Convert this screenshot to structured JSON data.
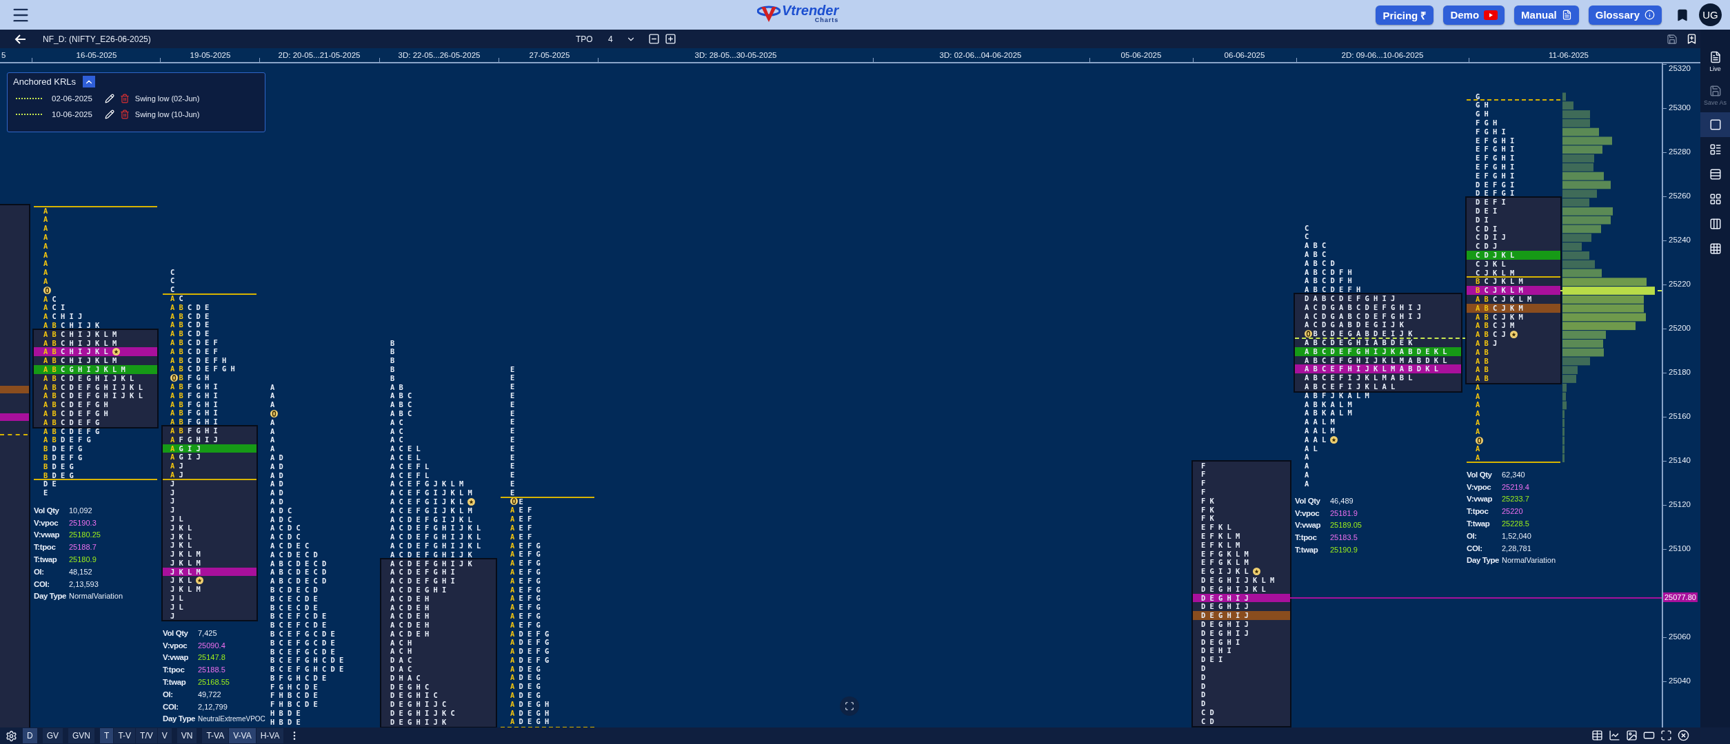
{
  "header": {
    "logo": "Vtrender",
    "logo_sub": "Charts",
    "buttons": [
      {
        "label": "Pricing ₹",
        "kind": "plain"
      },
      {
        "label": "Demo",
        "kind": "video"
      },
      {
        "label": "Manual",
        "kind": "doc"
      },
      {
        "label": "Glossary",
        "kind": "info"
      }
    ],
    "avatar": "UG"
  },
  "toolbar": {
    "title": "NF_D: (NIFTY_E26-06-2025)",
    "tpo_label": "TPO",
    "tpo_value": "4"
  },
  "timeline": [
    "5",
    "16-05-2025",
    "19-05-2025",
    "2D: 20-05...21-05-2025",
    "3D: 22-05...26-05-2025",
    "27-05-2025",
    "3D: 28-05...30-05-2025",
    "3D: 02-06...04-06-2025",
    "05-06-2025",
    "06-06-2025",
    "2D: 09-06...10-06-2025",
    "11-06-2025"
  ],
  "krl_panel": {
    "title": "Anchored KRLs",
    "expanded": true,
    "items": [
      {
        "date": "02-06-2025",
        "label": "Swing low (02-Jun)"
      },
      {
        "date": "10-06-2025",
        "label": "Swing low (10-Jun)"
      }
    ]
  },
  "profiles": [
    {
      "above": [
        {
          "ib": "A"
        },
        {
          "ib": "A"
        },
        {
          "ib": "A"
        },
        {
          "ib": "A"
        },
        {
          "ib": "A"
        },
        {
          "ib": "A"
        },
        {
          "ib": "A"
        },
        {
          "ib": "A"
        },
        {
          "ib": "A"
        },
        {
          "open": true
        },
        {
          "ib": "A",
          "tpos": "C"
        },
        {
          "ib": "A",
          "tpos": "C I"
        },
        {
          "ib": "A",
          "tpos": "C H I J"
        },
        {
          "ib": "A B",
          "tpos": "C H I J K"
        }
      ],
      "value_area": [
        {
          "ib": "A B",
          "tpos": "C H I J K L M"
        },
        {
          "ib": "A B",
          "tpos": "C H I J K L M"
        },
        {
          "ib": "A B",
          "tpos": "C H I J K L",
          "color": "#a8109c",
          "close": true
        },
        {
          "ib": "A B",
          "tpos": "C H I J K L M"
        },
        {
          "ib": "A B",
          "tpos": "C G H I J K L M",
          "color": "#169a16"
        },
        {
          "ib": "A B",
          "tpos": "C D E G H I J K L"
        },
        {
          "ib": "A B",
          "tpos": "C D E F G H I J K L"
        },
        {
          "ib": "A B",
          "tpos": "C D E F G H I J K L"
        },
        {
          "ib": "A B",
          "tpos": "C D E F G H"
        },
        {
          "ib": "A B",
          "tpos": "C D E F G H"
        },
        {
          "ib": "A B",
          "tpos": "C D E F G"
        }
      ],
      "below": [
        {
          "ib": "A B",
          "tpos": "C D E F G"
        },
        {
          "ib": "A B",
          "tpos": "D E F G"
        },
        {
          "ib": "B",
          "tpos": "D E F G"
        },
        {
          "ib": "B",
          "tpos": "D E F G"
        },
        {
          "ib": "B",
          "tpos": "D E G"
        },
        {
          "ib": "B",
          "tpos": "D E G"
        },
        "D E",
        "E"
      ],
      "stats": [
        {
          "label": "Vol Qty",
          "value": "10,092",
          "kind": "plain"
        },
        {
          "label": "V:vpoc",
          "value": "25190.3",
          "kind": "poc"
        },
        {
          "label": "V:vwap",
          "value": "25180.25",
          "kind": "avg"
        },
        {
          "label": "T:tpoc",
          "value": "25188.7",
          "kind": "poc"
        },
        {
          "label": "T:twap",
          "value": "25180.9",
          "kind": "avg"
        },
        {
          "label": "OI:",
          "value": "48,152",
          "kind": "plain"
        },
        {
          "label": "COI:",
          "value": "2,13,593",
          "kind": "plain"
        },
        {
          "label": "Day Type",
          "value": "NormalVariation",
          "kind": "plain"
        }
      ]
    },
    {
      "above": [
        "C",
        "C",
        "C",
        {
          "ib": "A",
          "tpos": "C"
        },
        {
          "ib": "A B",
          "tpos": "C D E"
        },
        {
          "ib": "A B",
          "tpos": "C D E"
        },
        {
          "ib": "A B",
          "tpos": "C D E"
        },
        {
          "ib": "A B",
          "tpos": "C D E"
        },
        {
          "ib": "A B",
          "tpos": "C D E F"
        },
        {
          "ib": "A B",
          "tpos": "C D E F"
        },
        {
          "ib": "A B",
          "tpos": "C D E F H"
        },
        {
          "ib": "A B",
          "tpos": "C D E F G H"
        },
        {
          "ib": "B",
          "tpos": "F G H",
          "open": true
        },
        {
          "ib": "A B",
          "tpos": "F G H I"
        },
        {
          "ib": "A B",
          "tpos": "F G H I"
        },
        {
          "ib": "A B",
          "tpos": "F G H I"
        },
        {
          "ib": "A B",
          "tpos": "F G H I"
        },
        {
          "ib": "A B",
          "tpos": "F G H I"
        }
      ],
      "value_area": [
        {
          "ib": "A B",
          "tpos": "F G H I"
        },
        {
          "ib": "A",
          "tpos": "F G H I J"
        },
        {
          "ib": "A",
          "tpos": "G I J",
          "color": "#169a16"
        },
        {
          "ib": "A",
          "tpos": "G I J"
        },
        {
          "ib": "A",
          "tpos": "J"
        },
        {
          "ib": "A",
          "tpos": "J"
        },
        "J",
        "J",
        "J",
        "J",
        "J L",
        "J K L",
        "J K L",
        "J K L",
        "J K L M",
        "J K L M",
        {
          "tpos": "J K L M",
          "color": "#a8109c"
        },
        {
          "tpos": "J K L",
          "close": true
        },
        "J K L M",
        "J L",
        "J L",
        "J"
      ],
      "stats": [
        {
          "label": "Vol Qty",
          "value": "7,425",
          "kind": "plain"
        },
        {
          "label": "V:vpoc",
          "value": "25090.4",
          "kind": "poc"
        },
        {
          "label": "V:vwap",
          "value": "25147.8",
          "kind": "avg"
        },
        {
          "label": "T:tpoc",
          "value": "25188.5",
          "kind": "poc"
        },
        {
          "label": "T:twap",
          "value": "25168.55",
          "kind": "avg"
        },
        {
          "label": "OI:",
          "value": "49,722",
          "kind": "plain"
        },
        {
          "label": "COI:",
          "value": "2,12,799",
          "kind": "plain"
        },
        {
          "label": "Day Type",
          "value": "NeutralExtremeVPOC",
          "kind": "plain"
        }
      ]
    },
    {
      "above": [
        "A",
        "A",
        "A",
        {
          "open": true
        },
        "A",
        "A",
        "A",
        "A",
        "A D",
        "A D",
        "A D",
        "A D",
        "A D",
        "A D",
        "A D C",
        "A D C",
        "A C D C",
        "A C D C",
        "A C D E C",
        "A C D E C D",
        "A B C D E C D",
        "A B C D E C D",
        "A B C D E C D",
        "B C D E C D",
        "B C E C D E",
        "B C E C D E",
        "B C E F C D E",
        "B C E F C D E",
        "B C E F G C D E",
        "B C E F G C D E",
        "B C E F G C D E",
        "B C E F G H C D E",
        "B C E F G H C D E",
        "B F G H C D E",
        "F G H C D E",
        "F H B C D E",
        "F H B C D E",
        "H B D E",
        "H B D E"
      ]
    },
    {
      "above": [
        "B",
        "B",
        "B",
        "B",
        "B",
        "A B",
        "A B C",
        "A B C",
        "A B C",
        "A C",
        "A C",
        "A C",
        "A C E L",
        "A C E L",
        "A C E F L",
        "A C E F L",
        "A C E F G J K L M",
        "A C E F G I J K L M",
        {
          "tpos": "A C E F G I J K L",
          "close": true
        },
        "A C E F G I J K L M",
        "A C D E F G I J K L",
        "A C D E F G H I J K L",
        "A C D E F G H I J K L",
        "A C D E F G H I J K L",
        "A C D E F G H I J K"
      ],
      "value_area": [
        "A C D E F G H I J K",
        "A C D E F G H I",
        "A C D E F G H I",
        "A C D E G H I",
        "A C D E H",
        "A C D E H",
        "A C D E H",
        "A C D E H",
        "A C D E H",
        "A C H",
        "A C H",
        "D A C",
        "D A C",
        "D H A C",
        "D E G H C",
        "D E G H I C",
        "D E G H I J C",
        "D E G H I J K C",
        "D E G H I J K"
      ]
    },
    {
      "above": [
        "E",
        "E",
        "E",
        "E",
        "E",
        "E",
        "E",
        "E",
        "E",
        "E",
        "E",
        "E",
        "E",
        "E",
        "E",
        {
          "tpos": "E",
          "open": true
        },
        {
          "ib": "A",
          "tpos": "E F"
        },
        {
          "ib": "A",
          "tpos": "E F"
        },
        {
          "ib": "A",
          "tpos": "E F"
        },
        {
          "ib": "A",
          "tpos": "E F"
        },
        {
          "ib": "A",
          "tpos": "E F G"
        },
        {
          "ib": "A",
          "tpos": "E F G"
        },
        {
          "ib": "A",
          "tpos": "E F G"
        },
        {
          "ib": "A",
          "tpos": "E F G"
        },
        {
          "ib": "A",
          "tpos": "E F G"
        },
        {
          "ib": "A",
          "tpos": "E F G"
        },
        {
          "ib": "A",
          "tpos": "E F G"
        },
        {
          "ib": "A",
          "tpos": "E F G"
        },
        {
          "ib": "A",
          "tpos": "E F G"
        },
        {
          "ib": "A",
          "tpos": "E F G"
        },
        {
          "ib": "A",
          "tpos": "D E F G"
        },
        {
          "ib": "A",
          "tpos": "D E F G"
        },
        {
          "ib": "A",
          "tpos": "D E F G"
        },
        {
          "ib": "A",
          "tpos": "D E F G"
        },
        {
          "ib": "A",
          "tpos": "D E G"
        },
        {
          "ib": "A",
          "tpos": "D E G"
        },
        {
          "ib": "A",
          "tpos": "D E G"
        },
        {
          "ib": "A",
          "tpos": "D E G"
        },
        {
          "ib": "A",
          "tpos": "D E G H"
        },
        {
          "ib": "A",
          "tpos": "D E G H"
        },
        {
          "ib": "A",
          "tpos": "D E G H"
        }
      ]
    },
    {
      "value_area": [
        "F",
        "F",
        "F",
        "F",
        "F K",
        "F K",
        "F K",
        "E F K L",
        "E F K L M",
        "E F K L M",
        "E F G K L M",
        "E F G K L M",
        {
          "tpos": "E G I J K L",
          "close": true
        },
        "D E G H I J K L M",
        "D E G H I J K L",
        {
          "tpos": "D E G H I J",
          "color": "#a8109c"
        },
        "D E G H I J",
        {
          "tpos": "D E G H I J",
          "color": "#8a4d1e"
        },
        "D E G H I J",
        "D E G H I J",
        "D E G H I",
        "D E H I",
        "D E I",
        "D",
        "D",
        "D",
        "D",
        "D",
        "C D",
        "C D"
      ]
    },
    {
      "above": [
        "C",
        "C",
        "A B C",
        "A B C",
        "A B C D",
        "A B C D F H",
        "A B C D F H",
        "A B C D E F H"
      ],
      "value_area": [
        "D A B C D E F G H I J",
        "A C D G A B C D E F G H I J",
        "A C D G A B C D E F G H I J",
        "A C D G A B D E G I J K",
        {
          "tpos": "B C D E G A B D E I J K",
          "open": true
        },
        "A B C D E G H I A B D E K",
        {
          "tpos": "A B C D E F G H I J K A B D E K L",
          "color": "#169a16"
        },
        "A B C E F G H I J K L M A B D K L",
        {
          "tpos": "A B C E F H I J K L M A B D K L",
          "color": "#a8109c"
        },
        "A B C E F I J K L M A B L",
        "A B C E F I J K L A L"
      ],
      "below": [
        "A B F J K A L M",
        "A B K A L M",
        "A B K A L M",
        "A A L M",
        "A A L M",
        {
          "tpos": "A A L",
          "close": true
        },
        "A L",
        "A",
        "A",
        "A",
        "A"
      ],
      "stats": [
        {
          "label": "Vol Qty",
          "value": "46,489",
          "kind": "plain"
        },
        {
          "label": "V:vpoc",
          "value": "25181.9",
          "kind": "poc"
        },
        {
          "label": "V:vwap",
          "value": "25189.05",
          "kind": "avg"
        },
        {
          "label": "T:tpoc",
          "value": "25183.5",
          "kind": "poc"
        },
        {
          "label": "T:twap",
          "value": "25190.9",
          "kind": "avg"
        }
      ]
    },
    {
      "above": [
        "G",
        "G H",
        "G H",
        "F G H",
        "F G H I",
        "E F G H I",
        "E F G H I",
        "E F G H I",
        "E F G H I",
        "E F G H I",
        "D E F G I",
        "D E F G I"
      ],
      "value_area": [
        "D E F I",
        "D E I",
        "D I",
        "C D I",
        "C D I J",
        "C D J",
        {
          "tpos": "C D J K L",
          "color": "#169a16"
        },
        "C J K L",
        "C J K L M",
        {
          "ib": "B",
          "tpos": "C J K L M"
        },
        {
          "ib": "B",
          "tpos": "C J K L M",
          "color": "#a8109c"
        },
        {
          "ib": "A B",
          "tpos": "C J K L M"
        },
        {
          "ib": "A B",
          "tpos": "C J K M",
          "color": "#8a4d1e"
        },
        {
          "ib": "A B",
          "tpos": "C J K M"
        },
        {
          "ib": "A B",
          "tpos": "C J M"
        },
        {
          "ib": "A B",
          "tpos": "C J",
          "close": true
        },
        {
          "ib": "A B",
          "tpos": "J"
        },
        {
          "ib": "A B"
        },
        {
          "ib": "A B"
        },
        {
          "ib": "A B"
        },
        {
          "ib": "A B"
        }
      ],
      "below": [
        {
          "ib": "A"
        },
        {
          "ib": "A"
        },
        {
          "ib": "A"
        },
        {
          "ib": "A"
        },
        {
          "ib": "A"
        },
        {
          "ib": "A"
        },
        {
          "open": true
        },
        {
          "ib": "A"
        },
        {
          "ib": "A"
        }
      ],
      "stats": [
        {
          "label": "Vol Qty",
          "value": "62,340",
          "kind": "plain"
        },
        {
          "label": "V:vpoc",
          "value": "25219.4",
          "kind": "poc"
        },
        {
          "label": "V:vwap",
          "value": "25233.7",
          "kind": "avg"
        },
        {
          "label": "T:tpoc",
          "value": "25220",
          "kind": "poc"
        },
        {
          "label": "T:twap",
          "value": "25228.5",
          "kind": "avg"
        },
        {
          "label": "OI:",
          "value": "1,52,040",
          "kind": "plain"
        },
        {
          "label": "COI:",
          "value": "2,28,781",
          "kind": "plain"
        },
        {
          "label": "Day Type",
          "value": "NormalVariation",
          "kind": "plain"
        }
      ]
    }
  ],
  "price_axis": {
    "labels": [
      "25320",
      "25300",
      "25280",
      "25260",
      "25240",
      "25220",
      "25200",
      "25180",
      "25160",
      "25140",
      "25120",
      "25100",
      "25060",
      "25040"
    ],
    "marker": "25077.80"
  },
  "sidebar": [
    {
      "label": "Live",
      "kind": "live",
      "disabled": false
    },
    {
      "label": "Save As",
      "kind": "save",
      "disabled": true
    },
    {
      "kind": "single",
      "selected": true
    },
    {
      "kind": "list",
      "selected": false
    },
    {
      "kind": "rows",
      "selected": false
    },
    {
      "kind": "grid",
      "selected": false
    },
    {
      "kind": "columns",
      "selected": false
    },
    {
      "kind": "matrix",
      "selected": false
    }
  ],
  "bottom_bar": {
    "groups": [
      [
        {
          "label": "D",
          "selected": true
        }
      ],
      [
        {
          "label": "GV",
          "selected": false
        }
      ],
      [
        {
          "label": "GVN",
          "selected": false
        }
      ],
      [
        {
          "label": "T",
          "selected": true
        },
        {
          "label": "T-V",
          "selected": false
        },
        {
          "label": "T/V",
          "selected": false
        },
        {
          "label": "V",
          "selected": false
        }
      ],
      [
        {
          "label": "VN",
          "selected": false
        }
      ],
      [
        {
          "label": "T-VA",
          "selected": false
        },
        {
          "label": "V-VA",
          "selected": true
        },
        {
          "label": "H-VA",
          "selected": false
        }
      ]
    ]
  }
}
